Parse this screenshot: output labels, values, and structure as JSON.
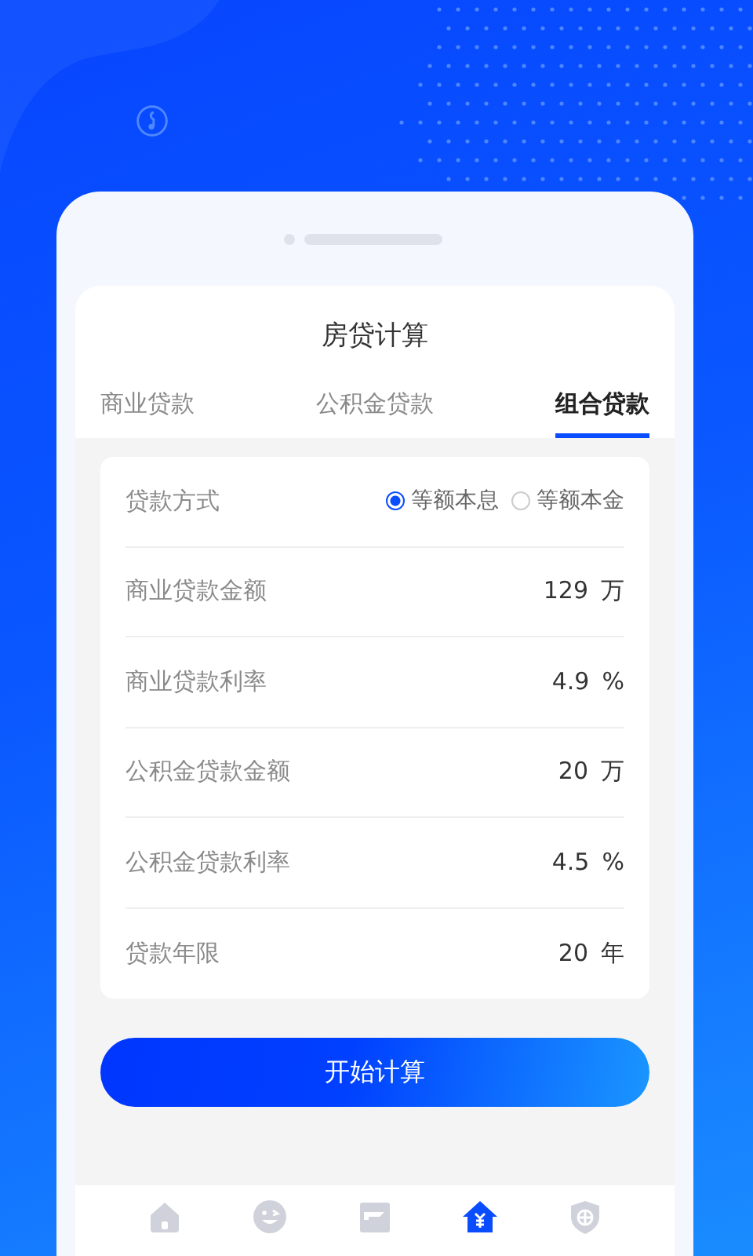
{
  "title": "房贷计算",
  "tabs": [
    {
      "label": "商业贷款",
      "selected": false
    },
    {
      "label": "公积金贷款",
      "selected": false
    },
    {
      "label": "组合贷款",
      "selected": true
    }
  ],
  "rows": [
    {
      "kind": "radio",
      "label": "贷款方式",
      "options": [
        {
          "label": "等额本息",
          "selected": true
        },
        {
          "label": "等额本金",
          "selected": false
        }
      ]
    },
    {
      "kind": "value",
      "label": "商业贷款金额",
      "value": "129",
      "unit": "万"
    },
    {
      "kind": "value",
      "label": "商业贷款利率",
      "value": "4.9",
      "unit": "%"
    },
    {
      "kind": "value",
      "label": "公积金贷款金额",
      "value": "20",
      "unit": "万"
    },
    {
      "kind": "value",
      "label": "公积金贷款利率",
      "value": "4.5",
      "unit": "%"
    },
    {
      "kind": "value",
      "label": "贷款年限",
      "value": "20",
      "unit": "年"
    }
  ],
  "button": "开始计算",
  "nav": [
    {
      "kind": "home",
      "selected": false
    },
    {
      "kind": "smile",
      "selected": false
    },
    {
      "kind": "card",
      "selected": false
    },
    {
      "kind": "loan",
      "selected": true
    },
    {
      "kind": "shield",
      "selected": false
    }
  ]
}
